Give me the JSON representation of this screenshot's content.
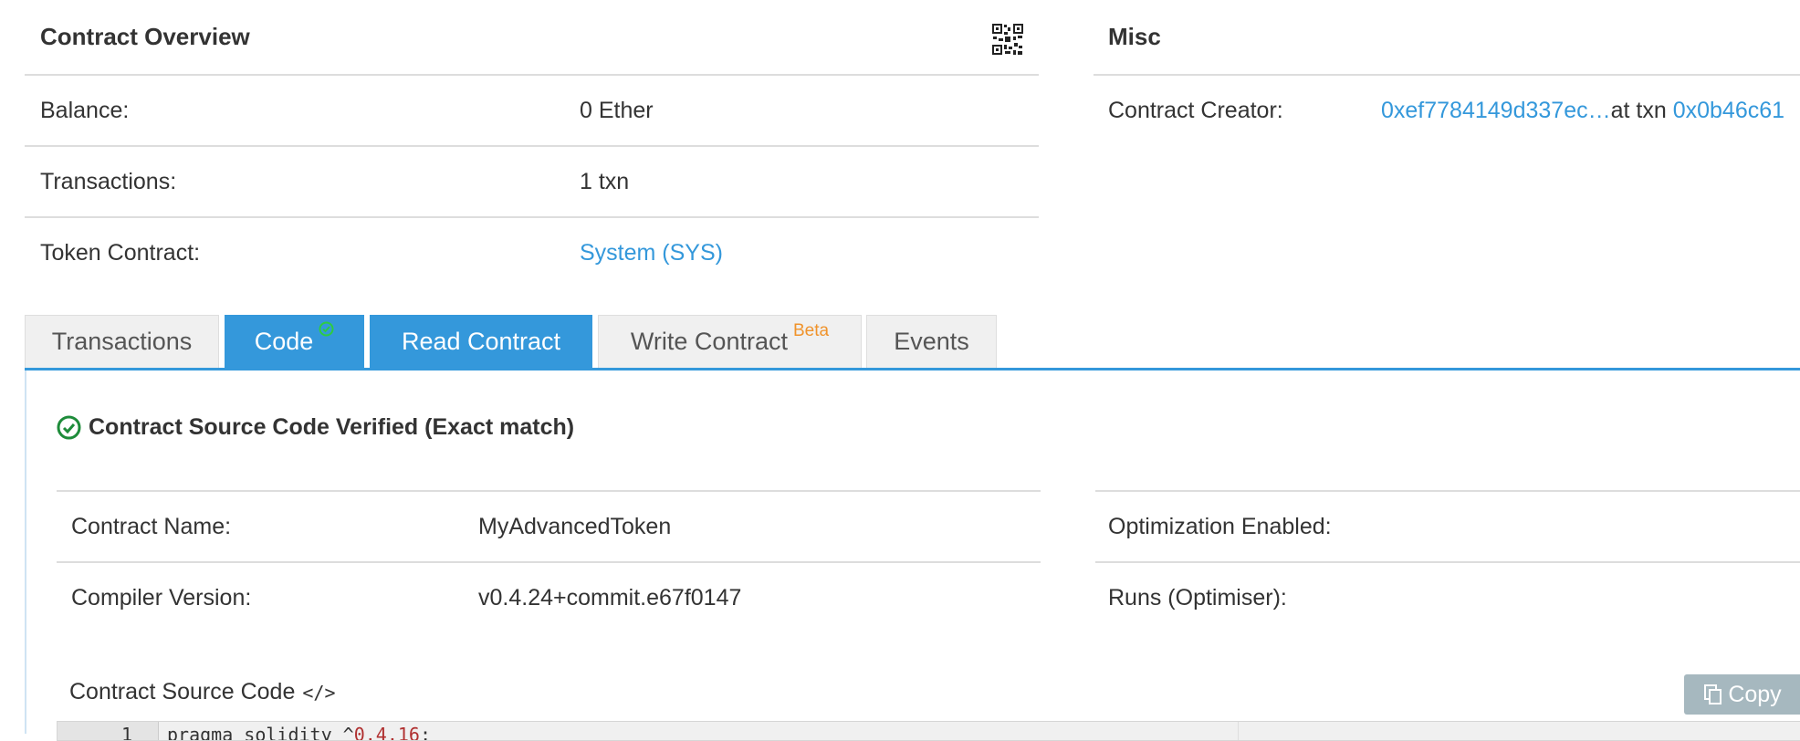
{
  "overview": {
    "title": "Contract Overview",
    "rows": [
      {
        "label": "Balance:",
        "value": "0 Ether"
      },
      {
        "label": "Transactions:",
        "value": "1 txn"
      },
      {
        "label": "Token Contract:",
        "value": "System (SYS)"
      }
    ]
  },
  "misc": {
    "title": "Misc",
    "creator_label": "Contract Creator:",
    "creator_address": "0xef7784149d337ec…",
    "at_txn_text": "at txn ",
    "txn_hash": "0x0b46c61"
  },
  "tabs": [
    {
      "label": "Transactions",
      "active": false
    },
    {
      "label": "Code",
      "active": true,
      "badge_icon": "check-circle-icon"
    },
    {
      "label": "Read Contract",
      "active": true
    },
    {
      "label": "Write Contract",
      "active": false,
      "sup": "Beta"
    },
    {
      "label": "Events",
      "active": false
    }
  ],
  "code_tab": {
    "verified_text": "Contract Source Code Verified (Exact match)",
    "info_left": [
      {
        "label": "Contract Name:",
        "value": "MyAdvancedToken"
      },
      {
        "label": "Compiler Version:",
        "value": "v0.4.24+commit.e67f0147"
      }
    ],
    "info_right": [
      {
        "label": "Optimization Enabled:",
        "value": ""
      },
      {
        "label": "Runs (Optimiser):",
        "value": ""
      }
    ],
    "source_title": "Contract Source Code",
    "source_icon": "</>",
    "copy_label": "Copy",
    "editor": {
      "line_number": "1",
      "code_keyword": "pragma solidity ^",
      "code_version": "0.4.16",
      "code_end": ";"
    }
  },
  "colors": {
    "link": "#3498db",
    "tab_active": "#3498db",
    "beta": "#f0932b",
    "verified_green": "#1e8c3a",
    "copy_button": "#a6b8bf"
  }
}
